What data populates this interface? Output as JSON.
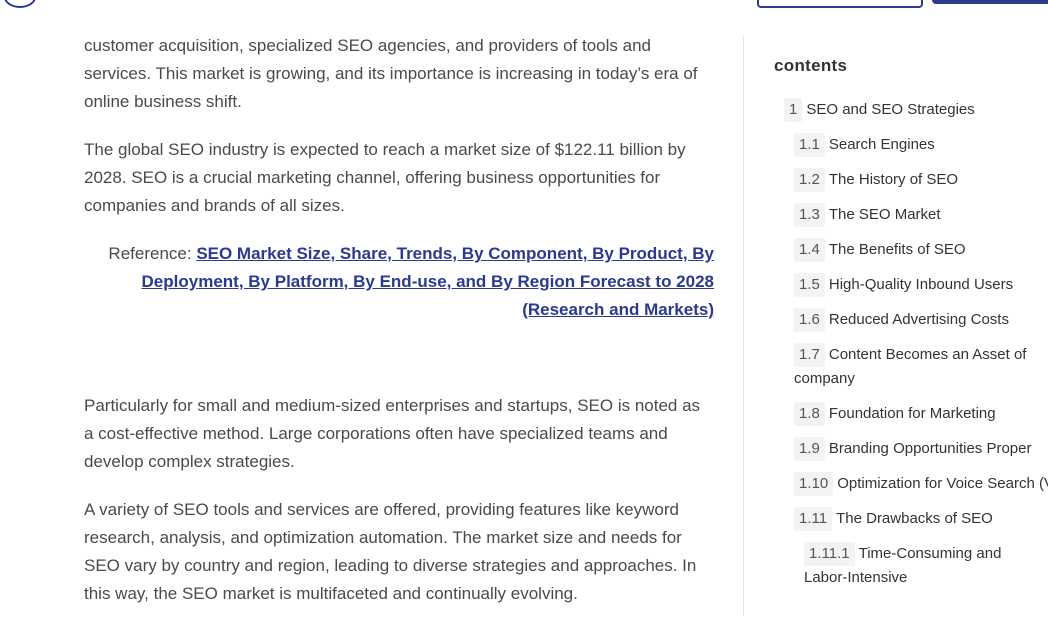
{
  "article": {
    "p1": "customer acquisition, specialized SEO agencies, and providers of tools and services. This market is growing, and its importance is increasing in today’s era of online business shift.",
    "p2": "The global SEO industry is expected to reach a market size of $122.11 billion by 2028. SEO is a crucial marketing channel, offering business opportunities for companies and brands of all sizes.",
    "reference_prefix": "Reference: ",
    "reference_link": "SEO Market Size, Share, Trends, By Component, By Product, By Deployment, By Platform, By End-use, and By Region Forecast to 2028 (Research and Markets)",
    "p3": "Particularly for small and medium-sized enterprises and startups, SEO is noted as a cost-effective method. Large corporations often have specialized teams and develop complex strategies.",
    "p4": "A variety of SEO tools and services are offered, providing features like keyword research, analysis, and optimization automation. The market size and needs for SEO vary by country and region, leading to diverse strategies and approaches. In this way, the SEO market is multifaceted and continually evolving."
  },
  "toc": {
    "title": "contents",
    "items": [
      {
        "num": "1",
        "label": "SEO and SEO Strategies"
      },
      {
        "num": "1.1",
        "label": "Search Engines"
      },
      {
        "num": "1.2",
        "label": "The History of SEO"
      },
      {
        "num": "1.3",
        "label": "The SEO Market"
      },
      {
        "num": "1.4",
        "label": "The Benefits of SEO"
      },
      {
        "num": "1.5",
        "label": "High-Quality Inbound Users"
      },
      {
        "num": "1.6",
        "label": "Reduced Advertising Costs"
      },
      {
        "num": "1.7",
        "label": "Content Becomes an Asset of company"
      },
      {
        "num": "1.8",
        "label": "Foundation for Marketing"
      },
      {
        "num": "1.9",
        "label": "Branding Opportunities Proper"
      },
      {
        "num": "1.10",
        "label": "Optimization for Voice Search (VS"
      },
      {
        "num": "1.11",
        "label": "The Drawbacks of SEO"
      },
      {
        "num": "1.11.1",
        "label": "Time-Consuming and Labor-Intensive"
      }
    ]
  },
  "colors": {
    "accent": "#2b3a8f",
    "body_text": "#4a4a4a"
  }
}
